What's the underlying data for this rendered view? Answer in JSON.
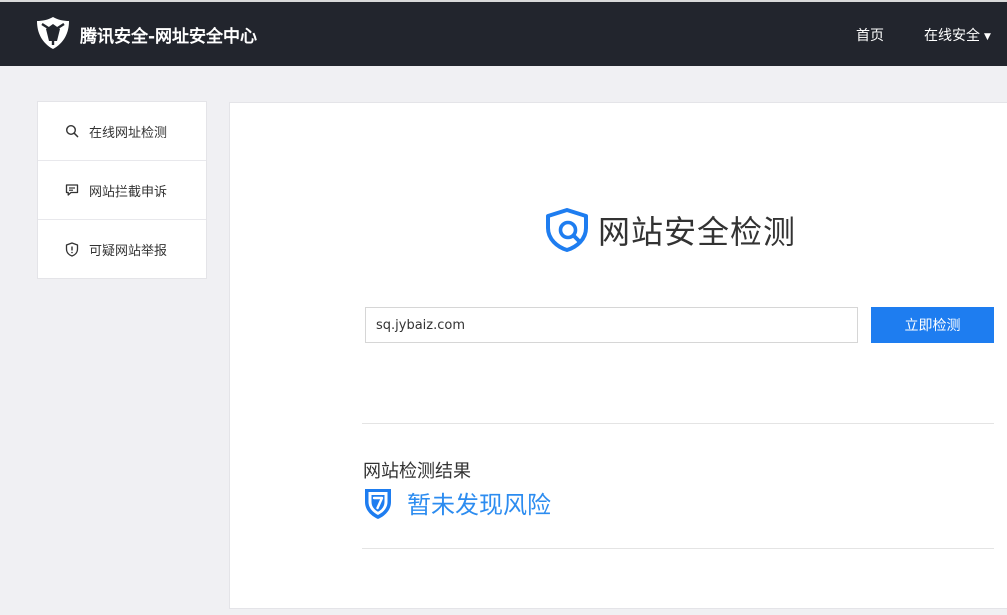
{
  "header": {
    "logo_icon": "tencent-shield-logo-icon",
    "brand": "腾讯安全-网址安全中心",
    "nav": {
      "home": "首页",
      "online_security": "在线安全",
      "dropdown_caret": "▼"
    }
  },
  "sidebar": {
    "items": [
      {
        "icon": "search-icon",
        "label": "在线网址检测"
      },
      {
        "icon": "chat-bubble-icon",
        "label": "网站拦截申诉"
      },
      {
        "icon": "shield-alert-icon",
        "label": "可疑网站举报"
      }
    ]
  },
  "main": {
    "title_icon": "shield-search-icon",
    "title": "网站安全检测",
    "url_input": {
      "value": "sq.jybaiz.com",
      "placeholder": ""
    },
    "check_button": "立即检测",
    "result": {
      "heading": "网站检测结果",
      "icon": "shield-check-icon",
      "status": "暂未发现风险"
    }
  },
  "colors": {
    "header_bg": "#22252d",
    "accent": "#1e7df0",
    "result_text": "#2c8cf0",
    "page_bg": "#f0f0f3"
  }
}
